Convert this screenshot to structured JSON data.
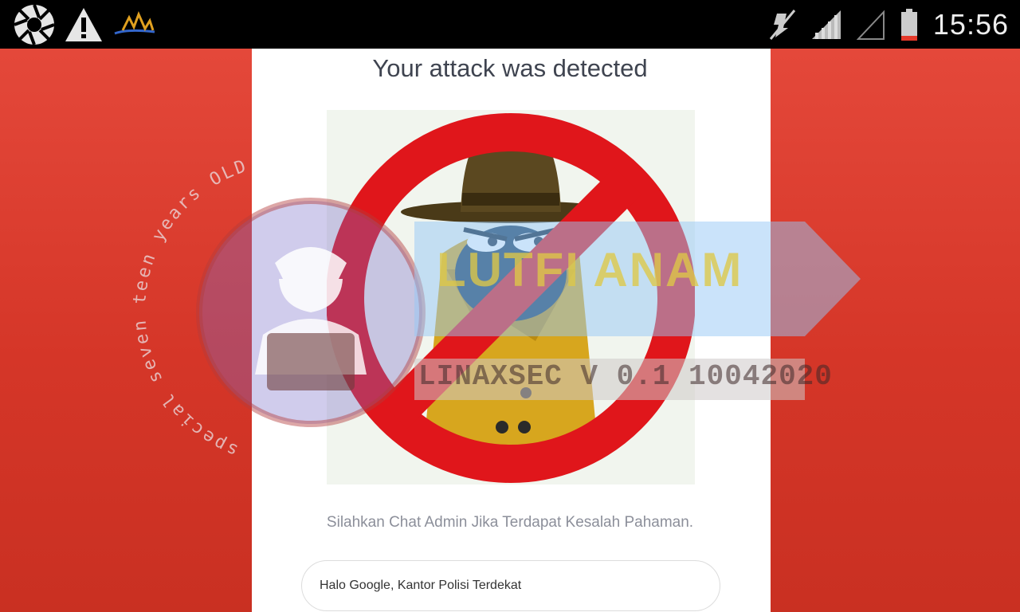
{
  "status_bar": {
    "time": "15:56",
    "left_icons": [
      "aperture-icon",
      "warning-icon",
      "app-logo-icon"
    ],
    "right_icons": [
      "mute-icon",
      "signal-icon",
      "signal-empty-icon",
      "battery-icon"
    ]
  },
  "page": {
    "title": "Your attack was detected",
    "subtitle": "Silahkan Chat Admin Jika Terdapat Kesalah Pahaman.",
    "chat_input": {
      "value": "Halo Google, Kantor Polisi Terdekat"
    },
    "hero_image": "no-spy-icon"
  },
  "watermark": {
    "arc_text": "special seven teen years OLD",
    "banner_text": "LUTFI ANAM",
    "strip_text": "LINAXSEC V 0.1 10042020"
  },
  "colors": {
    "background_red": "#d63a2c",
    "card": "#ffffff",
    "status_bar": "#000000",
    "prohibition_red": "#e0161b"
  }
}
